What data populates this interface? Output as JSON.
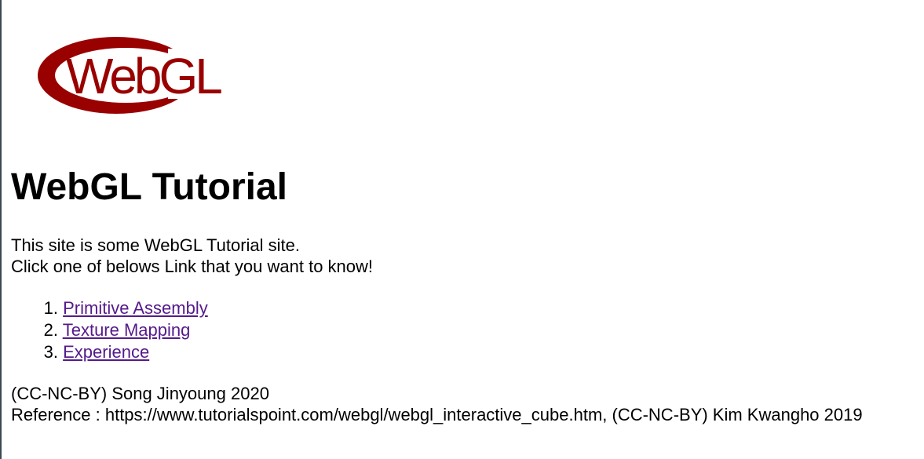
{
  "logo": {
    "text": "WebGL",
    "color": "#990000"
  },
  "page": {
    "title": "WebGL Tutorial",
    "intro_line1": "This site is some WebGL Tutorial site.",
    "intro_line2": "Click one of belows Link that you want to know!"
  },
  "links": [
    {
      "number": "1.",
      "label": "Primitive Assembly"
    },
    {
      "number": "2.",
      "label": "Texture Mapping"
    },
    {
      "number": "3.",
      "label": "Experience"
    }
  ],
  "footer": {
    "copyright": "(CC-NC-BY) Song Jinyoung 2020",
    "reference": "Reference : https://www.tutorialspoint.com/webgl/webgl_interactive_cube.htm, (CC-NC-BY) Kim Kwangho 2019"
  },
  "colors": {
    "link_visited": "#551a8b",
    "logo_red": "#990000"
  }
}
